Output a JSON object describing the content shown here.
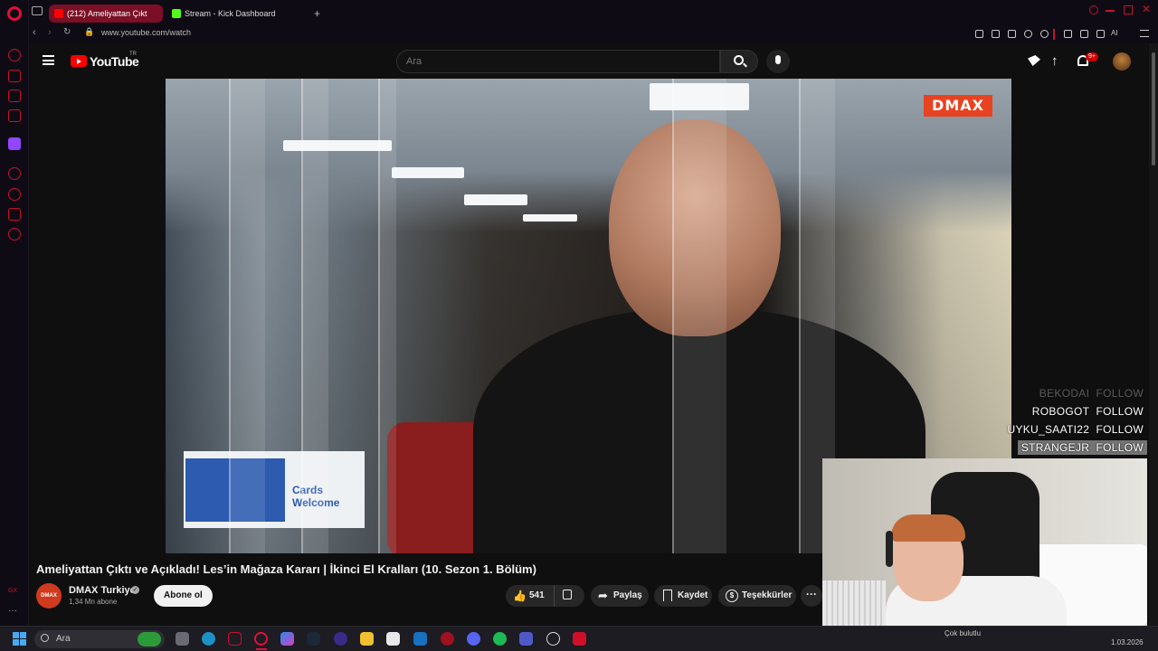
{
  "browser": {
    "tabs": [
      {
        "label": "(212) Ameliyattan Çıkt",
        "active": true
      },
      {
        "label": "Stream - Kick Dashboard",
        "active": false
      }
    ],
    "url": "www.youtube.com/watch",
    "ai_label": "AI"
  },
  "youtube": {
    "logo_text": "YouTube",
    "country_code": "TR",
    "search_placeholder": "Ara",
    "notification_count": "9+"
  },
  "video": {
    "channel_watermark": "DMAX",
    "sign_text": "Cards Welcome",
    "follow_alerts": [
      {
        "name": "BEKODAI",
        "action": "FOLLOW"
      },
      {
        "name": "ROBOGOT",
        "action": "FOLLOW"
      },
      {
        "name": "UYKU_SAATI22",
        "action": "FOLLOW"
      },
      {
        "name": "STRANGEJR",
        "action": "FOLLOW"
      }
    ]
  },
  "info": {
    "title": "Ameliyattan Çıktı ve Açıkladı! Les’in Mağaza Kararı | İkinci El Kralları (10. Sezon 1. Bölüm)",
    "channel_name": "DMAX Turkiye",
    "channel_avatar_text": "DMAX",
    "subscribers": "1,34 Mn abone",
    "subscribe_label": "Abone ol",
    "like_count": "541",
    "share_label": "Paylaş",
    "save_label": "Kaydet",
    "thanks_label": "Teşekkürler"
  },
  "taskbar": {
    "search_label": "Ara",
    "weather_text": "Çok bulutlu",
    "date_text": "1.03.2026"
  },
  "colors": {
    "accent": "#c8102e",
    "youtube_red": "#ff0000",
    "dmax_orange": "#e84320"
  }
}
